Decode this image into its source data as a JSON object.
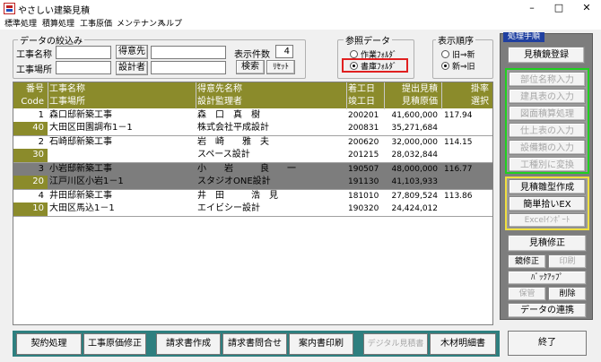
{
  "window": {
    "title": "やさしい建築見積",
    "minimize": "–",
    "maximize": "□",
    "close": "✕"
  },
  "menu": [
    "標準処理",
    "積算処理",
    "工事原価",
    "メンテナンス",
    "ヘルプ"
  ],
  "filter": {
    "title": "データの絞込み",
    "project_name_label": "工事名称",
    "project_place_label": "工事場所",
    "client_button": "得意先",
    "designer_button": "設計者",
    "count_label": "表示件数",
    "count_value": "4",
    "search_button": "検索",
    "reset_button": "ﾘｾｯﾄ"
  },
  "reference": {
    "title": "参照データ",
    "option1": "作業ﾌｫﾙﾀﾞ",
    "option2": "書庫ﾌｫﾙﾀﾞ",
    "selected": "option2"
  },
  "order": {
    "title": "表示順序",
    "option1": "旧⇒新",
    "option2": "新⇒旧",
    "selected": "option2"
  },
  "table": {
    "header": {
      "no": "番号",
      "code": "Code",
      "name": "工事名称",
      "place": "工事場所",
      "client": "得意先名称",
      "designer": "設計監理者",
      "start": "着工日",
      "finish": "竣工日",
      "amount": "提出見積",
      "cost": "見積原価",
      "rate": "掛率",
      "select": "選択"
    },
    "rows": [
      {
        "no": "1",
        "code": "40",
        "name": "森口邸新築工事",
        "place": "大田区田園調布1－1",
        "client": "森　口　真　樹",
        "designer": "株式会社平成設計",
        "start": "200201",
        "finish": "200831",
        "amount": "41,600,000",
        "cost": "35,271,684",
        "rate": "117.94",
        "selected": false
      },
      {
        "no": "2",
        "code": "30",
        "name": "石崎邸新築工事",
        "place": "",
        "client": "岩　崎　　雅　夫",
        "designer": "スペース設計",
        "start": "200620",
        "finish": "201215",
        "amount": "32,000,000",
        "cost": "28,032,844",
        "rate": "114.15",
        "selected": false
      },
      {
        "no": "3",
        "code": "20",
        "name": "小岩邸新築工事",
        "place": "江戸川区小岩1－1",
        "client": "小　　岩　　　良　　一",
        "designer": "スタジオONE設計",
        "start": "190507",
        "finish": "191130",
        "amount": "48,000,000",
        "cost": "41,103,933",
        "rate": "116.77",
        "selected": true
      },
      {
        "no": "4",
        "code": "10",
        "name": "井田邸新築工事",
        "place": "大田区馬込1－1",
        "client": "井　田　　　浩　見",
        "designer": "エイビシー設計",
        "start": "181010",
        "finish": "190320",
        "amount": "27,809,524",
        "cost": "24,424,012",
        "rate": "113.86",
        "selected": false
      }
    ]
  },
  "panel": {
    "title": "処理手順",
    "register": "見積鏡登録",
    "green": [
      "部位名称入力",
      "建具表の入力",
      "図面積算処理",
      "仕上表の入力",
      "設備類の入力",
      "工種別に変換"
    ],
    "yellow": [
      "見積雛型作成",
      "簡単拾いEX",
      "Excelｲﾝﾎﾟｰﾄ"
    ],
    "modify": "見積修正",
    "keymod": "鏡修正",
    "print": "印刷",
    "backup": "ﾊﾞｯｸｱｯﾌﾟ",
    "store": "保管",
    "delete": "削除",
    "link": "データの連携",
    "exit": "終了"
  },
  "bottom": [
    "契約処理",
    "工事原価修正",
    "請求書作成",
    "請求書問合せ",
    "案内書印刷",
    "デジタル見積書",
    "木材明細書"
  ],
  "colors": {
    "olive": "#8b8b2b",
    "grey_row": "#7d7d7d",
    "teal": "#2e7f7f",
    "highlight": "#e02020",
    "green": "#20d020",
    "yellow": "#f0e040"
  }
}
